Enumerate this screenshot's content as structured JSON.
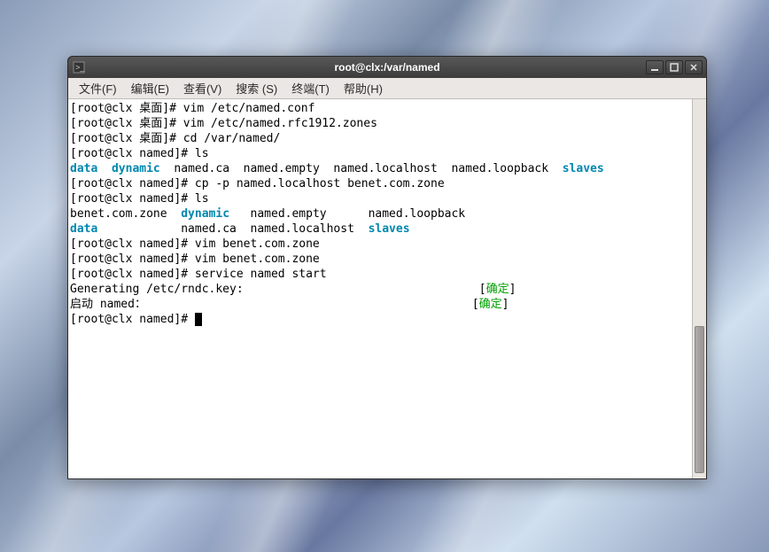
{
  "window": {
    "title": "root@clx:/var/named"
  },
  "menu": {
    "file": "文件(F)",
    "edit": "编辑(E)",
    "view": "查看(V)",
    "search": "搜索 (S)",
    "terminal": "终端(T)",
    "help": "帮助(H)"
  },
  "terminal": {
    "lines": [
      {
        "segs": [
          {
            "t": "[root@clx 桌面]# vim /etc/named.conf"
          }
        ]
      },
      {
        "segs": [
          {
            "t": "[root@clx 桌面]# vim /etc/named.rfc1912.zones"
          }
        ]
      },
      {
        "segs": [
          {
            "t": "[root@clx 桌面]# cd /var/named/"
          }
        ]
      },
      {
        "segs": [
          {
            "t": "[root@clx named]# ls"
          }
        ]
      },
      {
        "segs": [
          {
            "t": "data",
            "c": "cyan"
          },
          {
            "t": "  "
          },
          {
            "t": "dynamic",
            "c": "cyan"
          },
          {
            "t": "  named.ca  named.empty  named.localhost  named.loopback  "
          },
          {
            "t": "slaves",
            "c": "cyan"
          }
        ]
      },
      {
        "segs": [
          {
            "t": "[root@clx named]# cp -p named.localhost benet.com.zone"
          }
        ]
      },
      {
        "segs": [
          {
            "t": "[root@clx named]# ls"
          }
        ]
      },
      {
        "segs": [
          {
            "t": "benet.com.zone  "
          },
          {
            "t": "dynamic",
            "c": "cyan"
          },
          {
            "t": "   named.empty      named.loopback"
          }
        ]
      },
      {
        "segs": [
          {
            "t": "data",
            "c": "cyan"
          },
          {
            "t": "            named.ca  named.localhost  "
          },
          {
            "t": "slaves",
            "c": "cyan"
          }
        ]
      },
      {
        "segs": [
          {
            "t": "[root@clx named]# vim benet.com.zone"
          }
        ]
      },
      {
        "segs": [
          {
            "t": "[root@clx named]# vim benet.com.zone"
          }
        ]
      },
      {
        "segs": [
          {
            "t": "[root@clx named]# service named start"
          }
        ]
      },
      {
        "segs": [
          {
            "t": "Generating /etc/rndc.key:                                  ["
          },
          {
            "t": "确定",
            "c": "green"
          },
          {
            "t": "]"
          }
        ]
      },
      {
        "segs": [
          {
            "t": "启动 named：                                               ["
          },
          {
            "t": "确定",
            "c": "green"
          },
          {
            "t": "]"
          }
        ]
      },
      {
        "segs": [
          {
            "t": "[root@clx named]# "
          }
        ],
        "cursor": true
      }
    ]
  }
}
